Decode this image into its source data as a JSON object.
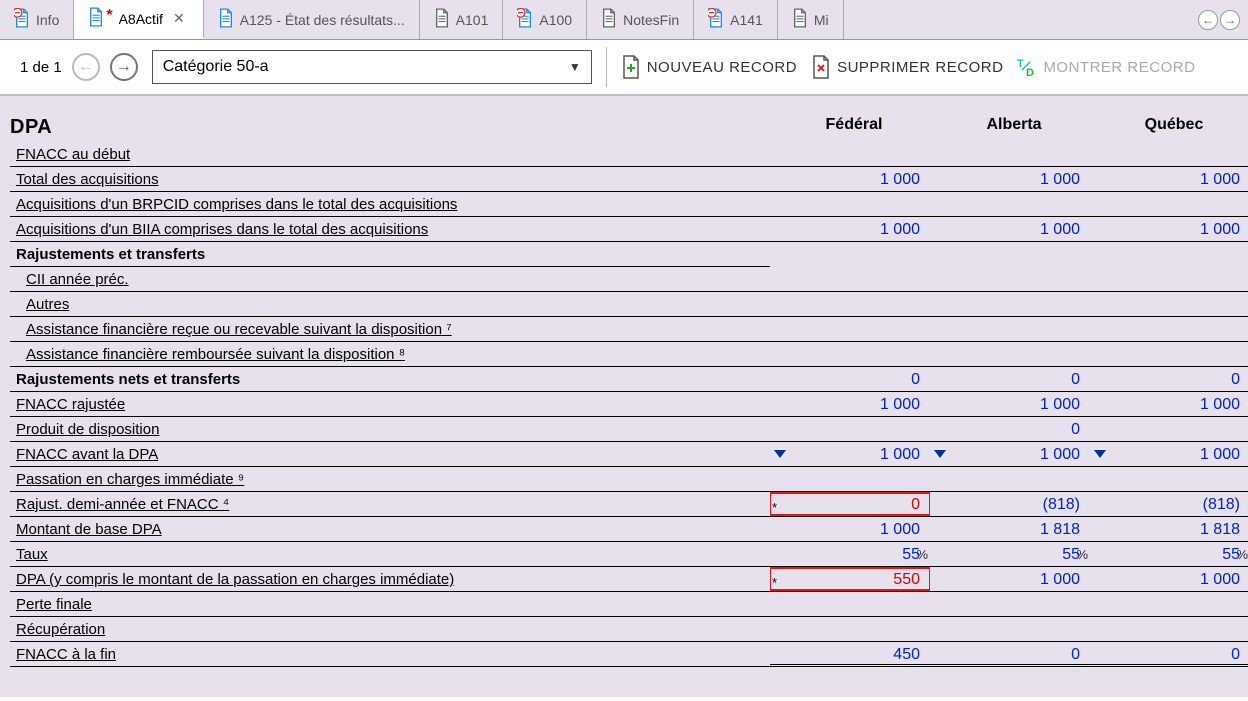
{
  "tabs": [
    {
      "label": "Info",
      "doccolor": "#1e88e5",
      "badge": "minus"
    },
    {
      "label": "A8Actif",
      "doccolor": "#1e88e5",
      "badge": "star",
      "active": true,
      "closable": true
    },
    {
      "label": "A125 - État des résultats...",
      "doccolor": "#1e88e5"
    },
    {
      "label": "A101",
      "doccolor": "#666"
    },
    {
      "label": "A100",
      "doccolor": "#1e88e5",
      "badge": "minus"
    },
    {
      "label": "NotesFin",
      "doccolor": "#666"
    },
    {
      "label": "A141",
      "doccolor": "#1e88e5",
      "badge": "minus"
    },
    {
      "label": "Mi",
      "doccolor": "#666",
      "cut": true
    }
  ],
  "toolbar": {
    "pager_text": "1 de 1",
    "combo_value": "Catégorie 50-a",
    "new_label": "NOUVEAU RECORD",
    "delete_label": "SUPPRIMER RECORD",
    "show_label": "MONTRER RECORD"
  },
  "columns": [
    "Fédéral",
    "Alberta",
    "Québec"
  ],
  "section_title": "DPA",
  "rows": [
    {
      "label": "FNACC au début",
      "indent": false,
      "u": true,
      "v": [
        "",
        "",
        ""
      ]
    },
    {
      "label": "Total des acquisitions",
      "indent": false,
      "u": true,
      "v": [
        "1 000",
        "1 000",
        "1 000"
      ]
    },
    {
      "label": "Acquisitions d'un BRPCID comprises dans le total des acquisitions",
      "indent": false,
      "u": true,
      "v": [
        "",
        "",
        ""
      ]
    },
    {
      "label": "Acquisitions d'un BIIA comprises dans le total des acquisitions",
      "indent": false,
      "u": true,
      "v": [
        "1 000",
        "1 000",
        "1 000"
      ]
    },
    {
      "label": "Rajustements et transferts",
      "bold": true,
      "nocells": true
    },
    {
      "label": "CII année préc.",
      "indent": true,
      "u": true,
      "v": [
        "",
        "",
        ""
      ]
    },
    {
      "label": "Autres",
      "indent": true,
      "u": true,
      "v": [
        "",
        "",
        ""
      ]
    },
    {
      "label": "Assistance financière reçue ou recevable suivant la disposition ⁷",
      "indent": true,
      "u": true,
      "v": [
        "",
        "",
        ""
      ]
    },
    {
      "label": "Assistance financière remboursée suivant la disposition ⁸",
      "indent": true,
      "u": true,
      "v": [
        "",
        "",
        ""
      ]
    },
    {
      "label": "Rajustements nets et transferts",
      "bold": true,
      "v": [
        "0",
        "0",
        "0"
      ]
    },
    {
      "label": "FNACC rajustée",
      "u": true,
      "v": [
        "1 000",
        "1 000",
        "1 000"
      ]
    },
    {
      "label": "Produit de disposition",
      "u": true,
      "v": [
        "",
        "0",
        ""
      ]
    },
    {
      "label": "FNACC avant la DPA",
      "u": true,
      "v": [
        "1 000",
        "1 000",
        "1 000"
      ],
      "arrow": true
    },
    {
      "label": "Passation en charges immédiate ⁹",
      "u": true,
      "v": [
        "",
        "",
        ""
      ]
    },
    {
      "label": "Rajust. demi-année et FNACC ⁴",
      "u": true,
      "v": [
        "0",
        "(818)",
        "(818)"
      ],
      "hl": [
        true,
        false,
        false
      ],
      "star": [
        true,
        false,
        false
      ]
    },
    {
      "label": "Montant de base DPA",
      "u": true,
      "v": [
        "1 000",
        "1 818",
        "1 818"
      ]
    },
    {
      "label": "Taux",
      "u": true,
      "v": [
        "55",
        "55",
        "55"
      ],
      "suffix": "%"
    },
    {
      "label": "DPA (y compris le montant de la passation en charges immédiate)",
      "u": true,
      "v": [
        "550",
        "1 000",
        "1 000"
      ],
      "hl": [
        true,
        false,
        false
      ],
      "star": [
        true,
        false,
        false
      ]
    },
    {
      "label": "Perte finale",
      "u": true,
      "v": [
        "",
        "",
        ""
      ]
    },
    {
      "label": "Récupération",
      "u": true,
      "v": [
        "",
        "",
        ""
      ]
    },
    {
      "label": "FNACC à la fin",
      "u": true,
      "v": [
        "450",
        "0",
        "0"
      ],
      "dbl": true
    }
  ]
}
